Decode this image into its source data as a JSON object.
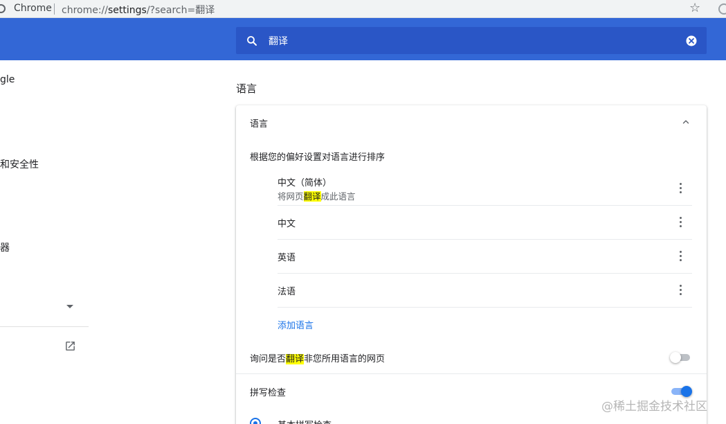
{
  "browser": {
    "site_name": "Chrome",
    "url_scheme": "chrome://",
    "url_host": "settings",
    "url_path": "/?search=翻译",
    "bookmark_icon": "star-icon"
  },
  "search": {
    "query": "翻译"
  },
  "sidebar": {
    "items": [
      {
        "label": "gle",
        "icon": ""
      },
      {
        "label": "和安全性",
        "icon": ""
      },
      {
        "label": "器",
        "icon": ""
      }
    ],
    "open_icon": "open-in-new-icon"
  },
  "section_title": "语言",
  "language_card": {
    "header_label": "语言",
    "order_label": "根据您的偏好设置对语言进行排序",
    "languages": [
      {
        "name": "中文（简体）",
        "sub_before": "将网页",
        "sub_highlight": "翻译",
        "sub_after": "成此语言"
      },
      {
        "name": "中文"
      },
      {
        "name": "英语"
      },
      {
        "name": "法语"
      }
    ],
    "add_language_label": "添加语言",
    "offer_translate": {
      "before": "询问是否",
      "highlight": "翻译",
      "after": "非您所用语言的网页",
      "enabled": false
    },
    "spellcheck": {
      "label": "拼写检查",
      "enabled": true
    },
    "basic_spellcheck_label": "基本拼写检查"
  },
  "colors": {
    "header_blue": "#3367d6",
    "search_blue": "#2a56c6",
    "link_blue": "#1a73e8",
    "highlight": "#ffff00"
  },
  "watermark": "@稀土掘金技术社区"
}
